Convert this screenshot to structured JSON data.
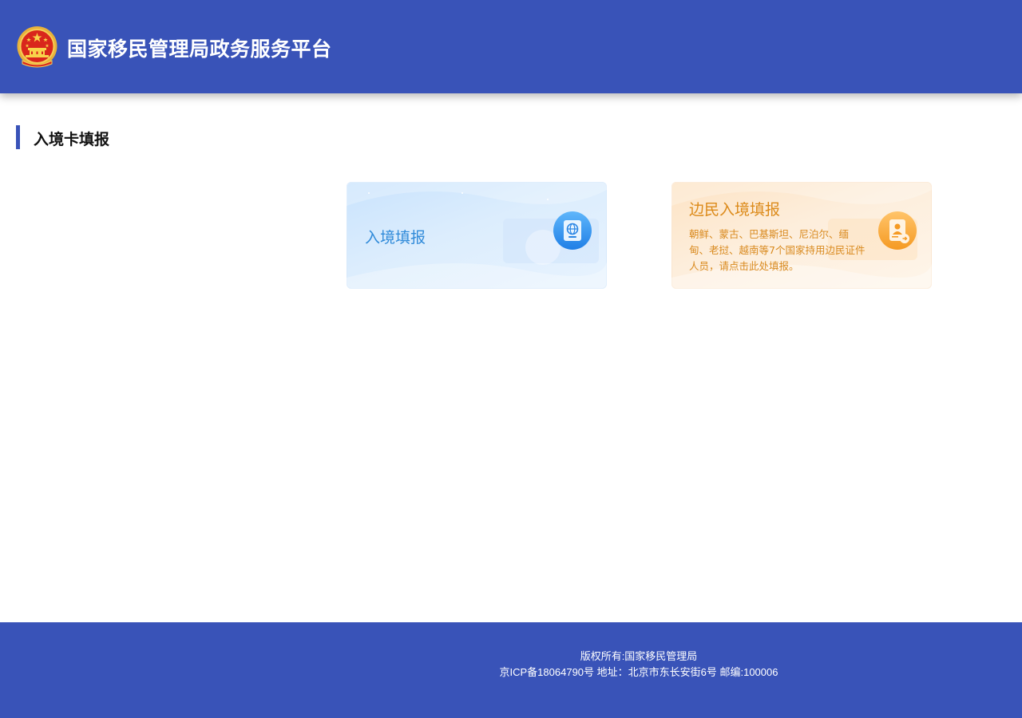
{
  "header": {
    "title": "国家移民管理局政务服务平台",
    "emblem_icon": "national-emblem-icon",
    "background_color": "#3953b8"
  },
  "section": {
    "title": "入境卡填报",
    "accent_color": "#3953b8"
  },
  "cards": [
    {
      "label": "入境填报",
      "icon": "passport-globe-icon",
      "theme_color": "#2f8ad9"
    },
    {
      "label": "边民入境填报",
      "description": "朝鲜、蒙古、巴基斯坦、尼泊尔、缅甸、老挝、越南等7个国家持用边民证件人员，请点击此处填报。",
      "icon": "id-card-person-icon",
      "theme_color": "#dc8a19"
    }
  ],
  "footer": {
    "copyright": "版权所有:国家移民管理局",
    "icp_address": "京ICP备18064790号 地址：北京市东长安街6号 邮编:100006"
  }
}
